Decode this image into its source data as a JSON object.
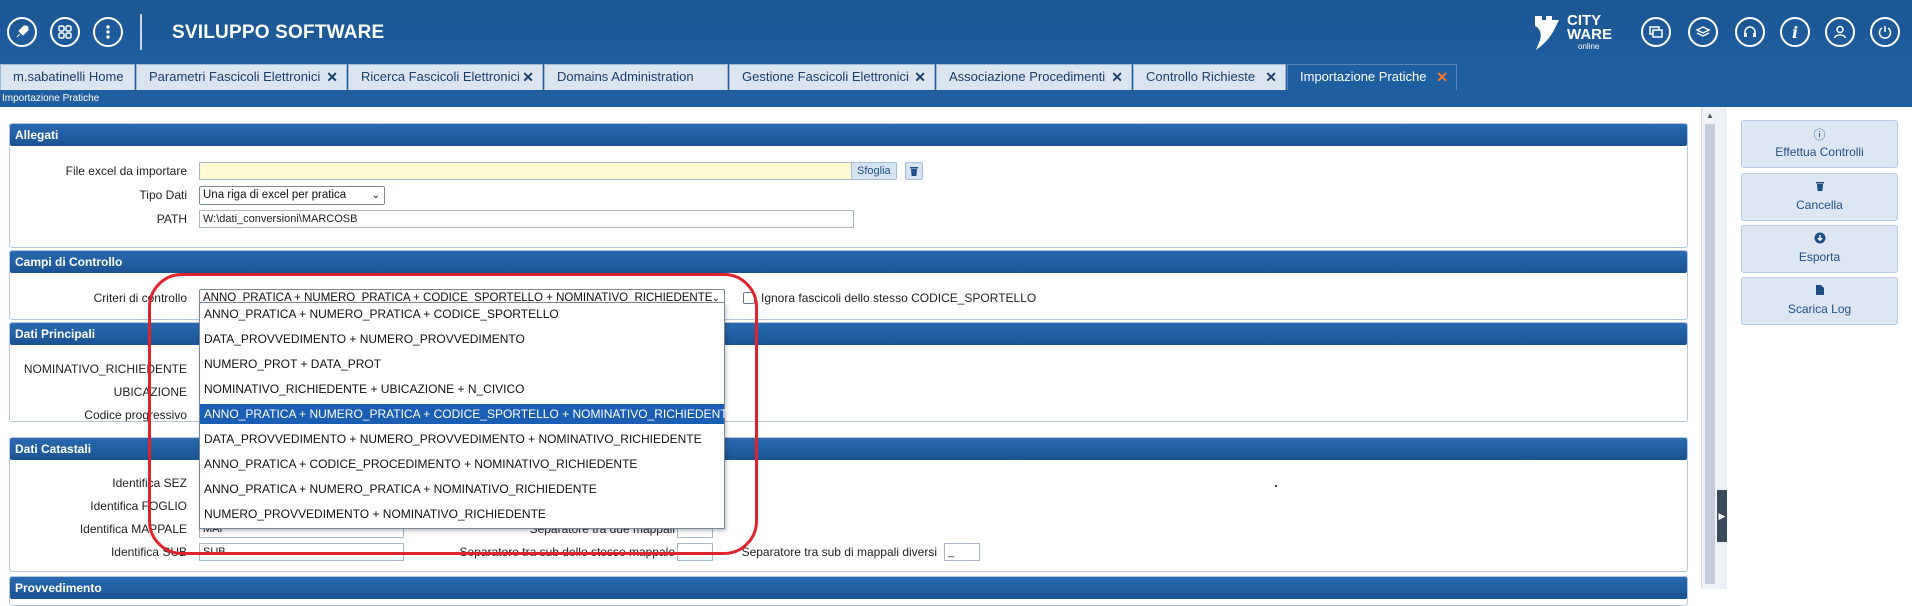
{
  "header": {
    "title": "SVILUPPO SOFTWARE",
    "left_icons": [
      "rocket-icon",
      "grid-icon",
      "more-vertical-icon"
    ],
    "logo": {
      "line1": "CITY",
      "line2": "WARE",
      "line3": "online"
    },
    "right_icons": [
      "windows-icon",
      "layers-icon",
      "headset-icon",
      "info-icon",
      "user-icon",
      "power-icon"
    ]
  },
  "tabs": [
    {
      "label": "m.sabatinelli Home",
      "closable": false
    },
    {
      "label": "Parametri Fascicoli Elettronici",
      "closable": true
    },
    {
      "label": "Ricerca Fascicoli Elettronici",
      "closable": true
    },
    {
      "label": "Domains Administration",
      "closable": false
    },
    {
      "label": "Gestione Fascicoli Elettronici",
      "closable": true
    },
    {
      "label": "Associazione Procedimenti",
      "closable": true
    },
    {
      "label": "Controllo Richieste",
      "closable": true
    },
    {
      "label": "Importazione Pratiche",
      "closable": true,
      "active": true
    }
  ],
  "close_glyph": "✕",
  "breadcrumb": "Importazione Pratiche",
  "allegati": {
    "title": "Allegati",
    "file_label": "File excel da importare",
    "file_value": "",
    "browse_label": "Sfoglia",
    "tipo_label": "Tipo Dati",
    "tipo_value": "Una riga di excel per pratica",
    "path_label": "PATH",
    "path_value": "W:\\dati_conversioni\\MARCOSB"
  },
  "campi": {
    "title": "Campi di Controllo",
    "criteri_label": "Criteri di controllo",
    "criteri_value": "ANNO_PRATICA + NUMERO_PRATICA + CODICE_SPORTELLO + NOMINATIVO_RICHIEDENTE",
    "ignora_label": "Ignora fascicoli dello stesso CODICE_SPORTELLO",
    "options": [
      "ANNO_PRATICA + NUMERO_PRATICA + CODICE_SPORTELLO",
      "DATA_PROVVEDIMENTO + NUMERO_PROVVEDIMENTO",
      "NUMERO_PROT + DATA_PROT",
      "NOMINATIVO_RICHIEDENTE + UBICAZIONE + N_CIVICO",
      "ANNO_PRATICA + NUMERO_PRATICA + CODICE_SPORTELLO + NOMINATIVO_RICHIEDENTE",
      "DATA_PROVVEDIMENTO + NUMERO_PROVVEDIMENTO + NOMINATIVO_RICHIEDENTE",
      "ANNO_PRATICA + CODICE_PROCEDIMENTO + NOMINATIVO_RICHIEDENTE",
      "ANNO_PRATICA + NUMERO_PRATICA + NOMINATIVO_RICHIEDENTE",
      "NUMERO_PROVVEDIMENTO + NOMINATIVO_RICHIEDENTE"
    ],
    "selected_index": 4
  },
  "principali": {
    "title": "Dati Principali",
    "nominativo_label": "NOMINATIVO_RICHIEDENTE",
    "ubicazione_label": "UBICAZIONE",
    "codice_label": "Codice progressivo"
  },
  "catastali": {
    "title": "Dati Catastali",
    "sez_label": "Identifica SEZ",
    "foglio_label": "Identifica FOGLIO",
    "mappale_label": "Identifica MAPPALE",
    "mappale_value": "MAP",
    "sub_label": "Identifica SUB",
    "sub_value": "SUB",
    "sep_mappali_label": "Separatore tra due mappali",
    "sep_sub_stesso_label": "Separatore tra sub dello stesso mappale",
    "sep_sub_diversi_label": "Separatore tra sub di mappali diversi",
    "sep_sub_diversi_value": "_"
  },
  "provvedimento": {
    "title": "Provvedimento"
  },
  "actions": [
    {
      "label": "Effettua Controlli",
      "icon": "info-circle-icon",
      "glyph": "ⓘ"
    },
    {
      "label": "Cancella",
      "icon": "trash-icon",
      "glyph": "🗑"
    },
    {
      "label": "Esporta",
      "icon": "download-circle-icon",
      "glyph": "⬇"
    },
    {
      "label": "Scarica Log",
      "icon": "file-icon",
      "glyph": "▤"
    }
  ],
  "colors": {
    "header": "#1f5e9f",
    "accent_close": "#ff7b2e",
    "annotation": "#e0242b",
    "selected_option": "#1a5fb4"
  }
}
